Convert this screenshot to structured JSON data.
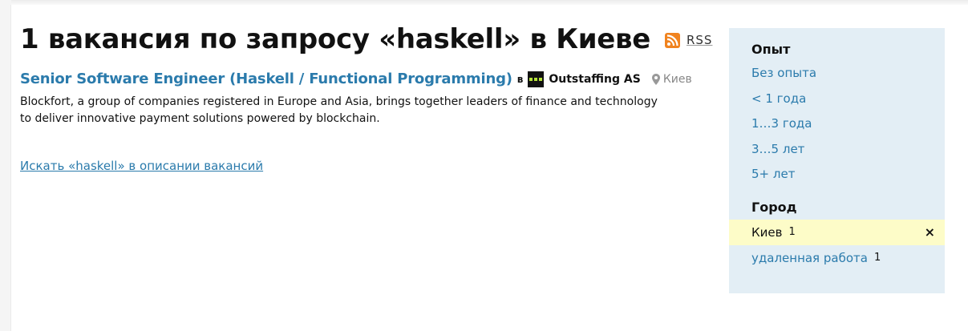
{
  "header": {
    "title": "1 вакансия по запросу «haskell» в Киеве",
    "rss_label": "RSS"
  },
  "vacancy": {
    "title": "Senior Software Engineer (Haskell / Functional Programming)",
    "in_label": "в",
    "company": "Outstaffing AS",
    "city": "Киев",
    "description": "Blockfort, a group of companies registered in Europe and Asia, brings together leaders of finance and technology to deliver innovative payment solutions powered by blockchain."
  },
  "search_link": "Искать «haskell» в описании вакансий",
  "sidebar": {
    "experience": {
      "heading": "Опыт",
      "items": [
        "Без опыта",
        "< 1 года",
        "1…3 года",
        "3…5 лет",
        "5+ лет"
      ]
    },
    "city": {
      "heading": "Город",
      "items": [
        {
          "label": "Киев",
          "count": "1",
          "active": true,
          "remove": "×"
        },
        {
          "label": "удаленная работа",
          "count": "1",
          "active": false
        }
      ]
    }
  },
  "colors": {
    "link": "#2b7bac",
    "sidebar_bg": "#e3eef5",
    "active_bg": "#fdfcc8",
    "rss": "#f0831f",
    "logo_dots": "#b6e33a"
  },
  "icons": {
    "rss": "rss-icon",
    "company_logo": "company-logo-icon",
    "location": "map-pin-icon",
    "remove": "close-icon"
  }
}
